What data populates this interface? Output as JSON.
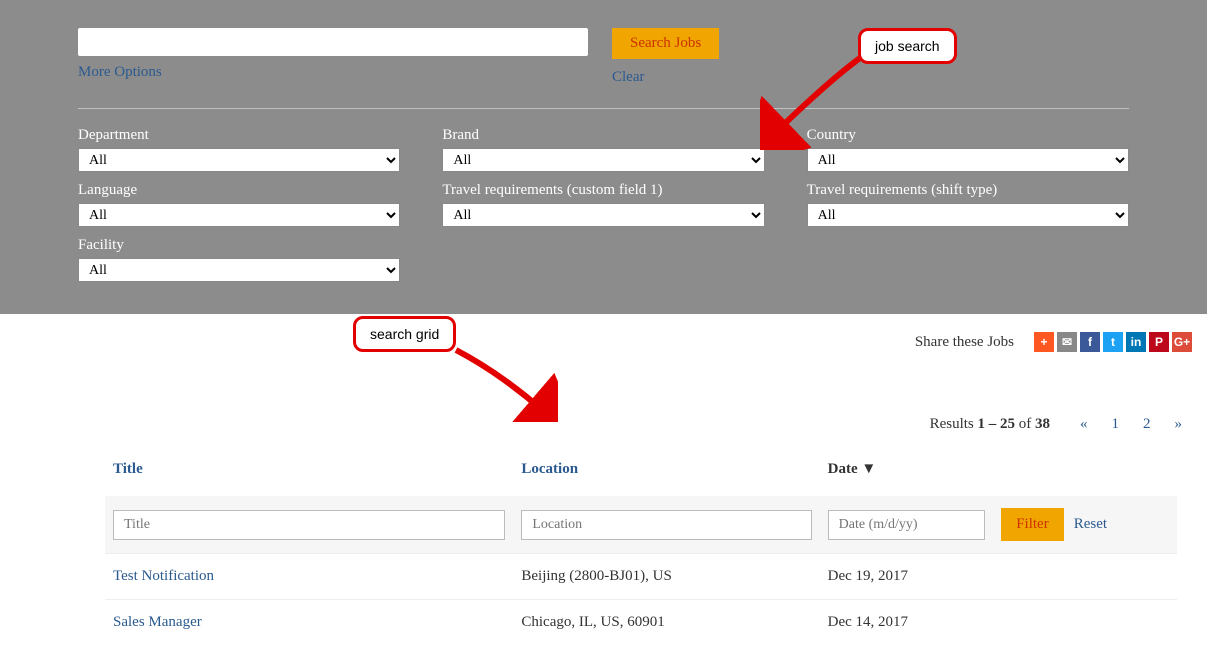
{
  "search": {
    "input_value": "",
    "placeholder": "",
    "button_label": "Search Jobs",
    "clear_label": "Clear",
    "more_options": "More Options"
  },
  "filters": {
    "items": [
      {
        "label": "Department",
        "value": "All"
      },
      {
        "label": "Brand",
        "value": "All"
      },
      {
        "label": "Country",
        "value": "All"
      },
      {
        "label": "Language",
        "value": "All"
      },
      {
        "label": "Travel requirements (custom field 1)",
        "value": "All"
      },
      {
        "label": "Travel requirements (shift type)",
        "value": "All"
      },
      {
        "label": "Facility",
        "value": "All"
      }
    ]
  },
  "share": {
    "text": "Share these Jobs",
    "icons": {
      "plus": "+",
      "mail": "✉",
      "fb": "f",
      "tw": "t",
      "in": "in",
      "pin": "P",
      "gp": "G+"
    }
  },
  "pagination": {
    "results_prefix": "Results ",
    "range": "1 – 25",
    "of": " of ",
    "total": "38",
    "prev": "«",
    "pages": [
      "1",
      "2"
    ],
    "next": "»"
  },
  "grid": {
    "headers": {
      "title": "Title",
      "location": "Location",
      "date": "Date",
      "date_sort_indicator": "▼"
    },
    "filter_row": {
      "title_placeholder": "Title",
      "location_placeholder": "Location",
      "date_placeholder": "Date (m/d/yy)",
      "filter_button": "Filter",
      "reset_link": "Reset"
    },
    "rows": [
      {
        "title": "Test Notification",
        "location": "Beijing (2800-BJ01), US",
        "date": "Dec 19, 2017"
      },
      {
        "title": "Sales Manager",
        "location": "Chicago, IL, US, 60901",
        "date": "Dec 14, 2017"
      }
    ]
  },
  "annotations": {
    "job_search": "job search",
    "search_grid": "search grid"
  }
}
